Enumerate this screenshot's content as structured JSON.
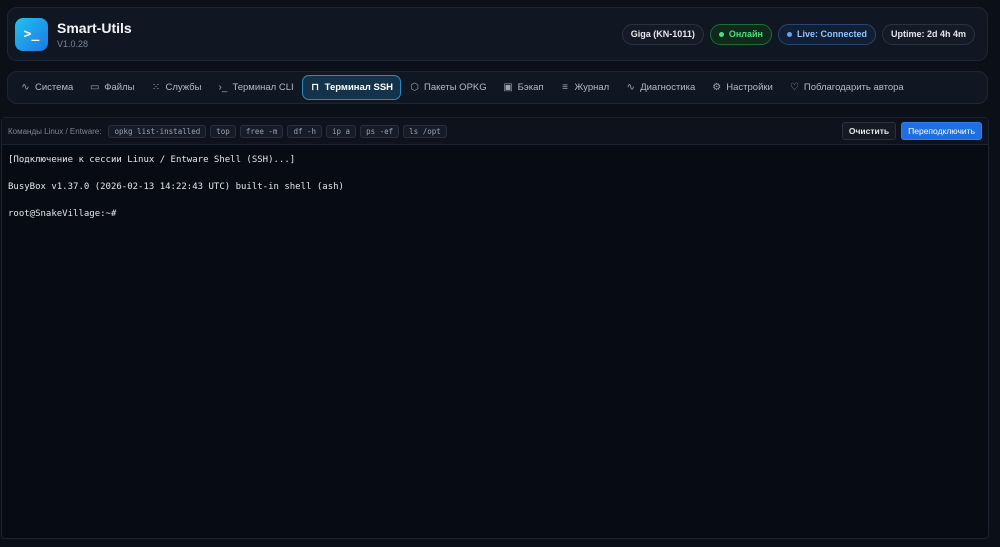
{
  "header": {
    "logo_glyph": ">_",
    "title": "Smart-Utils",
    "version": "V1.0.28",
    "badges": {
      "device": "Giga (KN-1011)",
      "online": "Онлайн",
      "live": "Live: Connected",
      "uptime": "Uptime: 2d 4h 4m"
    }
  },
  "nav": {
    "tabs": [
      {
        "label": "Система",
        "icon": "activity-icon"
      },
      {
        "label": "Файлы",
        "icon": "folder-icon"
      },
      {
        "label": "Службы",
        "icon": "loader-icon"
      },
      {
        "label": "Терминал CLI",
        "icon": "terminal-icon"
      },
      {
        "label": "Терминал SSH",
        "icon": "lock-icon",
        "active": true
      },
      {
        "label": "Пакеты OPKG",
        "icon": "package-icon"
      },
      {
        "label": "Бэкап",
        "icon": "save-icon"
      },
      {
        "label": "Журнал",
        "icon": "list-icon"
      },
      {
        "label": "Диагностика",
        "icon": "pulse-icon"
      },
      {
        "label": "Настройки",
        "icon": "gear-icon"
      },
      {
        "label": "Поблагодарить автора",
        "icon": "heart-icon"
      }
    ]
  },
  "toolbar": {
    "label": "Команды Linux / Entware:",
    "commands": [
      "opkg list-installed",
      "top",
      "free -m",
      "df -h",
      "ip a",
      "ps -ef",
      "ls /opt"
    ],
    "clear_label": "Очистить",
    "reconnect_label": "Переподключить"
  },
  "terminal": {
    "lines": [
      "[Подключение к сессии Linux / Entware Shell (SSH)...]",
      "",
      "BusyBox v1.37.0 (2026-02-13 14:22:43 UTC) built-in shell (ash)",
      "",
      "root@SnakeVillage:~#"
    ]
  },
  "colors": {
    "accent": "#1f6fe0",
    "online": "#4ade80",
    "active_tab": "#14324a"
  }
}
